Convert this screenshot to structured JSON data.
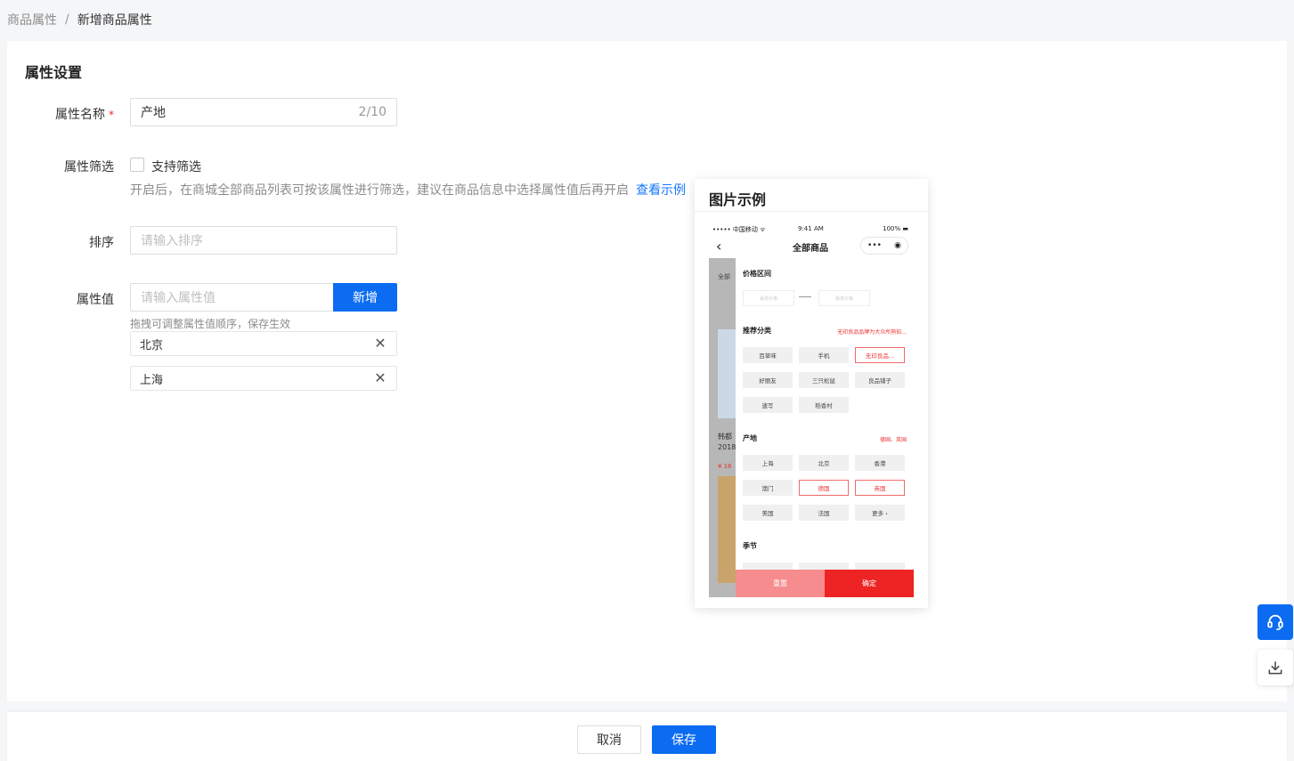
{
  "breadcrumb": {
    "parent": "商品属性",
    "separator": "/",
    "current": "新增商品属性"
  },
  "section": {
    "title": "属性设置"
  },
  "form": {
    "name": {
      "label": "属性名称",
      "required_mark": "*",
      "value": "产地",
      "counter": "2/10"
    },
    "filter": {
      "label": "属性筛选",
      "checkbox_label": "支持筛选",
      "help_text": "开启后，在商城全部商品列表可按该属性进行筛选，建议在商品信息中选择属性值后再开启",
      "help_link": "查看示例"
    },
    "sort": {
      "label": "排序",
      "placeholder": "请输入排序"
    },
    "values": {
      "label": "属性值",
      "placeholder": "请输入属性值",
      "add_button": "新增",
      "hint": "拖拽可调整属性值顺序，保存生效",
      "items": [
        "北京",
        "上海"
      ],
      "close_glyph": "✕"
    }
  },
  "preview": {
    "title": "图片示例",
    "status": {
      "carrier": "••••• 中国移动 ᯤ",
      "time": "9:41 AM",
      "battery": "100% ▬"
    },
    "nav": {
      "back": "‹",
      "title": "全部商品",
      "more": "•••",
      "target": "◉"
    },
    "bg": {
      "t1": "全部",
      "t2": "韩都\n2018",
      "t3": "¥ 16"
    },
    "price": {
      "label": "价格区间",
      "min": "最低价格",
      "max": "最高价格"
    },
    "category": {
      "label": "推荐分类",
      "selected_text": "无印良品品牌为大众所熟知...",
      "chips": [
        "百草味",
        "手机",
        "无印良品...",
        "好丽友",
        "三只松鼠",
        "良品铺子",
        "速写",
        "稻香村"
      ]
    },
    "origin": {
      "label": "产地",
      "selected_text": "德国、英国",
      "chips": [
        "上海",
        "北京",
        "香港",
        "澳门",
        "德国",
        "英国",
        "美国",
        "法国",
        "更多 ›"
      ]
    },
    "season": {
      "label": "季节"
    },
    "buttons": {
      "reset": "重置",
      "confirm": "确定"
    }
  },
  "footer": {
    "cancel": "取消",
    "save": "保存"
  },
  "floating": {
    "service": "headset-icon",
    "download": "download-icon"
  },
  "colors": {
    "primary": "#0b6cf2",
    "danger": "#ee2323",
    "link": "#1677ff"
  }
}
